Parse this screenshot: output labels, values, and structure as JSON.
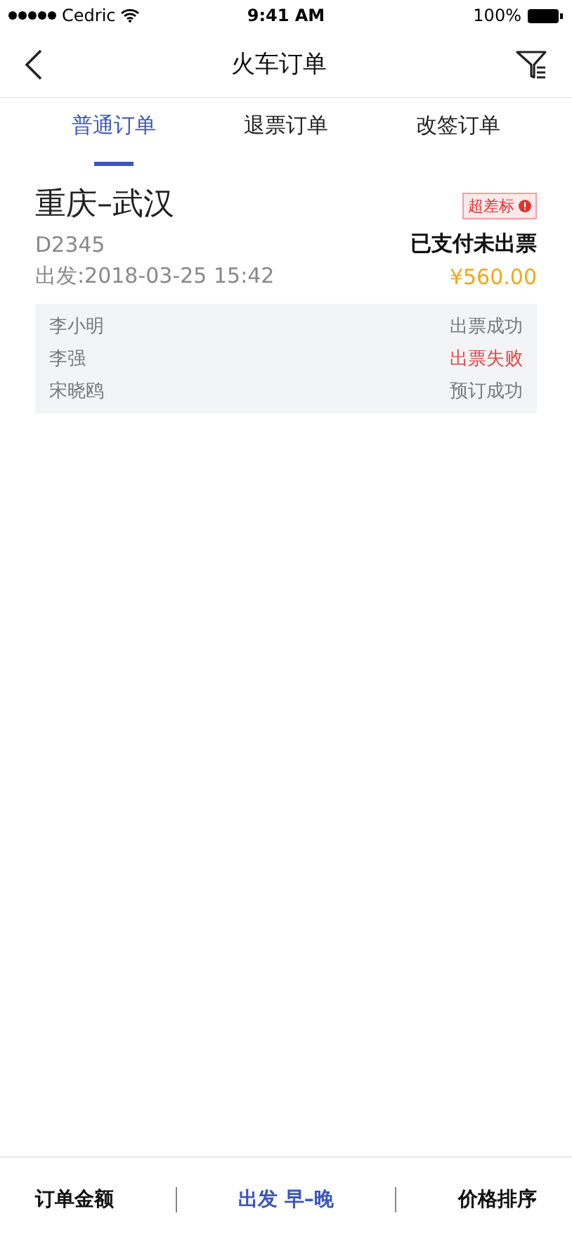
{
  "status_bar": {
    "carrier": "Cedric",
    "time": "9:41 AM",
    "battery": "100%"
  },
  "nav": {
    "title": "火车订单"
  },
  "tabs": [
    {
      "label": "普通订单",
      "selected": true
    },
    {
      "label": "退票订单",
      "selected": false
    },
    {
      "label": "改签订单",
      "selected": false
    }
  ],
  "orders": [
    {
      "route": "重庆–武汉",
      "badge": "超差标",
      "train": "D2345",
      "status": "已支付未出票",
      "departure": "出发:2018-03-25 15:42",
      "price": "¥560.00",
      "passengers": [
        {
          "name": "李小明",
          "status": "出票成功",
          "failed": false
        },
        {
          "name": "李强",
          "status": "出票失败",
          "failed": true
        },
        {
          "name": "宋晓鸥",
          "status": "预订成功",
          "failed": false
        }
      ]
    }
  ],
  "bottom_bar": [
    {
      "label": "订单金额",
      "selected": false
    },
    {
      "label": "出发 早–晚",
      "selected": true
    },
    {
      "label": "价格排序",
      "selected": false
    }
  ]
}
